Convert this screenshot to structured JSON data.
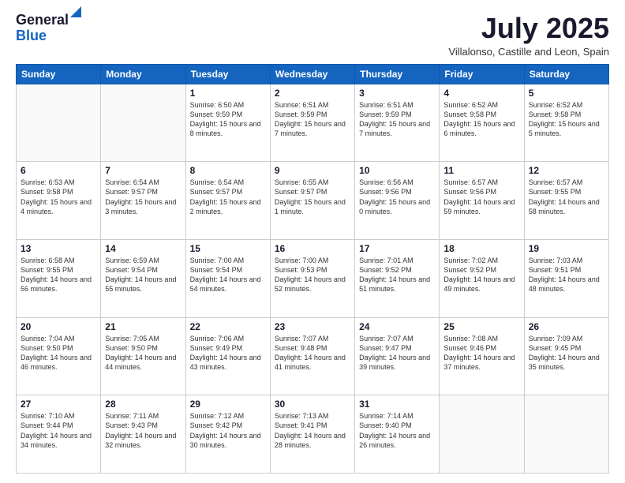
{
  "logo": {
    "general": "General",
    "blue": "Blue"
  },
  "header": {
    "month": "July 2025",
    "location": "Villalonso, Castille and Leon, Spain"
  },
  "weekdays": [
    "Sunday",
    "Monday",
    "Tuesday",
    "Wednesday",
    "Thursday",
    "Friday",
    "Saturday"
  ],
  "weeks": [
    [
      {
        "day": "",
        "sunrise": "",
        "sunset": "",
        "daylight": ""
      },
      {
        "day": "",
        "sunrise": "",
        "sunset": "",
        "daylight": ""
      },
      {
        "day": "1",
        "sunrise": "Sunrise: 6:50 AM",
        "sunset": "Sunset: 9:59 PM",
        "daylight": "Daylight: 15 hours and 8 minutes."
      },
      {
        "day": "2",
        "sunrise": "Sunrise: 6:51 AM",
        "sunset": "Sunset: 9:59 PM",
        "daylight": "Daylight: 15 hours and 7 minutes."
      },
      {
        "day": "3",
        "sunrise": "Sunrise: 6:51 AM",
        "sunset": "Sunset: 9:59 PM",
        "daylight": "Daylight: 15 hours and 7 minutes."
      },
      {
        "day": "4",
        "sunrise": "Sunrise: 6:52 AM",
        "sunset": "Sunset: 9:58 PM",
        "daylight": "Daylight: 15 hours and 6 minutes."
      },
      {
        "day": "5",
        "sunrise": "Sunrise: 6:52 AM",
        "sunset": "Sunset: 9:58 PM",
        "daylight": "Daylight: 15 hours and 5 minutes."
      }
    ],
    [
      {
        "day": "6",
        "sunrise": "Sunrise: 6:53 AM",
        "sunset": "Sunset: 9:58 PM",
        "daylight": "Daylight: 15 hours and 4 minutes."
      },
      {
        "day": "7",
        "sunrise": "Sunrise: 6:54 AM",
        "sunset": "Sunset: 9:57 PM",
        "daylight": "Daylight: 15 hours and 3 minutes."
      },
      {
        "day": "8",
        "sunrise": "Sunrise: 6:54 AM",
        "sunset": "Sunset: 9:57 PM",
        "daylight": "Daylight: 15 hours and 2 minutes."
      },
      {
        "day": "9",
        "sunrise": "Sunrise: 6:55 AM",
        "sunset": "Sunset: 9:57 PM",
        "daylight": "Daylight: 15 hours and 1 minute."
      },
      {
        "day": "10",
        "sunrise": "Sunrise: 6:56 AM",
        "sunset": "Sunset: 9:56 PM",
        "daylight": "Daylight: 15 hours and 0 minutes."
      },
      {
        "day": "11",
        "sunrise": "Sunrise: 6:57 AM",
        "sunset": "Sunset: 9:56 PM",
        "daylight": "Daylight: 14 hours and 59 minutes."
      },
      {
        "day": "12",
        "sunrise": "Sunrise: 6:57 AM",
        "sunset": "Sunset: 9:55 PM",
        "daylight": "Daylight: 14 hours and 58 minutes."
      }
    ],
    [
      {
        "day": "13",
        "sunrise": "Sunrise: 6:58 AM",
        "sunset": "Sunset: 9:55 PM",
        "daylight": "Daylight: 14 hours and 56 minutes."
      },
      {
        "day": "14",
        "sunrise": "Sunrise: 6:59 AM",
        "sunset": "Sunset: 9:54 PM",
        "daylight": "Daylight: 14 hours and 55 minutes."
      },
      {
        "day": "15",
        "sunrise": "Sunrise: 7:00 AM",
        "sunset": "Sunset: 9:54 PM",
        "daylight": "Daylight: 14 hours and 54 minutes."
      },
      {
        "day": "16",
        "sunrise": "Sunrise: 7:00 AM",
        "sunset": "Sunset: 9:53 PM",
        "daylight": "Daylight: 14 hours and 52 minutes."
      },
      {
        "day": "17",
        "sunrise": "Sunrise: 7:01 AM",
        "sunset": "Sunset: 9:52 PM",
        "daylight": "Daylight: 14 hours and 51 minutes."
      },
      {
        "day": "18",
        "sunrise": "Sunrise: 7:02 AM",
        "sunset": "Sunset: 9:52 PM",
        "daylight": "Daylight: 14 hours and 49 minutes."
      },
      {
        "day": "19",
        "sunrise": "Sunrise: 7:03 AM",
        "sunset": "Sunset: 9:51 PM",
        "daylight": "Daylight: 14 hours and 48 minutes."
      }
    ],
    [
      {
        "day": "20",
        "sunrise": "Sunrise: 7:04 AM",
        "sunset": "Sunset: 9:50 PM",
        "daylight": "Daylight: 14 hours and 46 minutes."
      },
      {
        "day": "21",
        "sunrise": "Sunrise: 7:05 AM",
        "sunset": "Sunset: 9:50 PM",
        "daylight": "Daylight: 14 hours and 44 minutes."
      },
      {
        "day": "22",
        "sunrise": "Sunrise: 7:06 AM",
        "sunset": "Sunset: 9:49 PM",
        "daylight": "Daylight: 14 hours and 43 minutes."
      },
      {
        "day": "23",
        "sunrise": "Sunrise: 7:07 AM",
        "sunset": "Sunset: 9:48 PM",
        "daylight": "Daylight: 14 hours and 41 minutes."
      },
      {
        "day": "24",
        "sunrise": "Sunrise: 7:07 AM",
        "sunset": "Sunset: 9:47 PM",
        "daylight": "Daylight: 14 hours and 39 minutes."
      },
      {
        "day": "25",
        "sunrise": "Sunrise: 7:08 AM",
        "sunset": "Sunset: 9:46 PM",
        "daylight": "Daylight: 14 hours and 37 minutes."
      },
      {
        "day": "26",
        "sunrise": "Sunrise: 7:09 AM",
        "sunset": "Sunset: 9:45 PM",
        "daylight": "Daylight: 14 hours and 35 minutes."
      }
    ],
    [
      {
        "day": "27",
        "sunrise": "Sunrise: 7:10 AM",
        "sunset": "Sunset: 9:44 PM",
        "daylight": "Daylight: 14 hours and 34 minutes."
      },
      {
        "day": "28",
        "sunrise": "Sunrise: 7:11 AM",
        "sunset": "Sunset: 9:43 PM",
        "daylight": "Daylight: 14 hours and 32 minutes."
      },
      {
        "day": "29",
        "sunrise": "Sunrise: 7:12 AM",
        "sunset": "Sunset: 9:42 PM",
        "daylight": "Daylight: 14 hours and 30 minutes."
      },
      {
        "day": "30",
        "sunrise": "Sunrise: 7:13 AM",
        "sunset": "Sunset: 9:41 PM",
        "daylight": "Daylight: 14 hours and 28 minutes."
      },
      {
        "day": "31",
        "sunrise": "Sunrise: 7:14 AM",
        "sunset": "Sunset: 9:40 PM",
        "daylight": "Daylight: 14 hours and 26 minutes."
      },
      {
        "day": "",
        "sunrise": "",
        "sunset": "",
        "daylight": ""
      },
      {
        "day": "",
        "sunrise": "",
        "sunset": "",
        "daylight": ""
      }
    ]
  ]
}
